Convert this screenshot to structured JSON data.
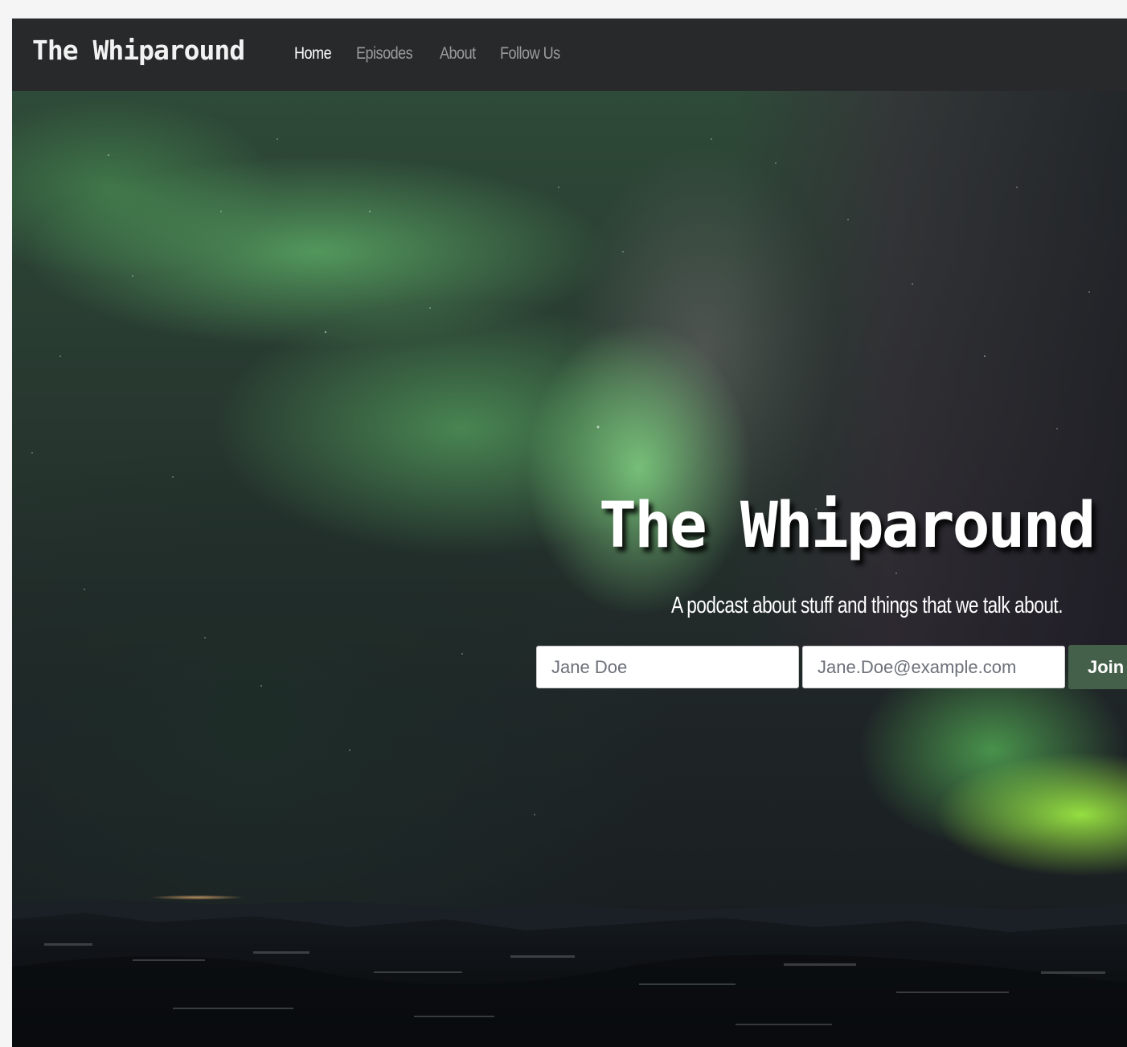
{
  "navbar": {
    "brand": "The Whiparound",
    "links": [
      {
        "label": "Home",
        "active": true
      },
      {
        "label": "Episodes",
        "active": false
      },
      {
        "label": "About",
        "active": false
      },
      {
        "label": "Follow Us",
        "active": false
      }
    ]
  },
  "hero": {
    "title": "The Whiparound",
    "subtitle": "A podcast about stuff and things that we talk about.",
    "signup": {
      "name_placeholder": "Jane Doe",
      "email_placeholder": "Jane.Doe@example.com",
      "join_label": "Join"
    }
  },
  "colors": {
    "navbar_bg": "#28292b",
    "nav_active": "#ffffff",
    "nav_inactive": "#9b9b9b",
    "join_button": "#45604a"
  }
}
